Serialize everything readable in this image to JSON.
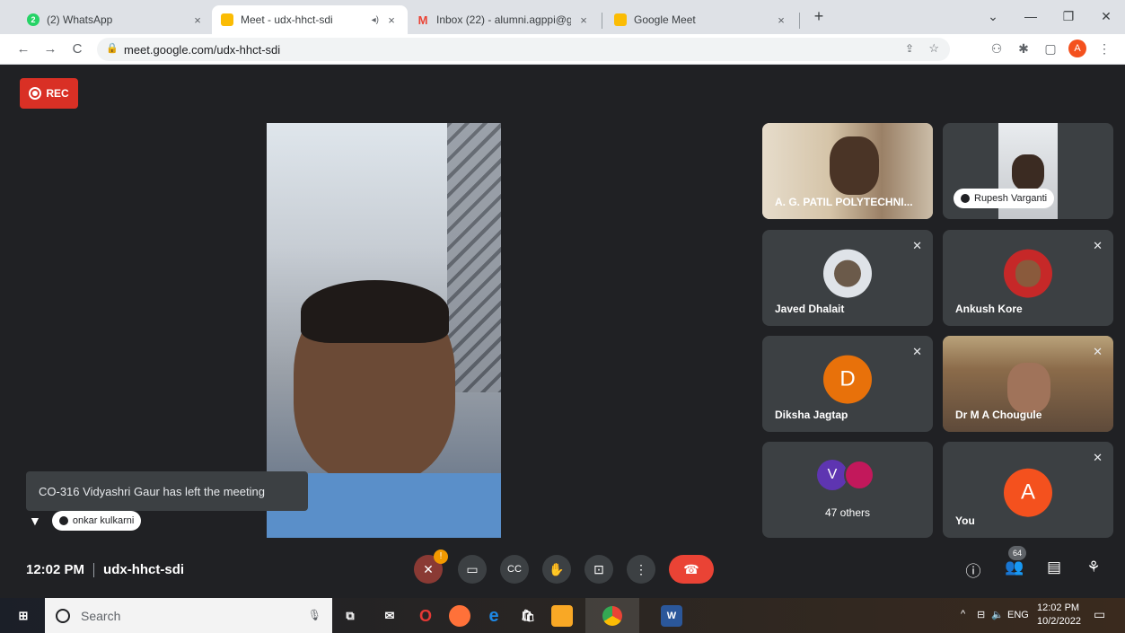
{
  "browser": {
    "tabs": [
      {
        "title": "(2) WhatsApp",
        "icon": "whatsapp-icon",
        "close": "×"
      },
      {
        "title": "Meet - udx-hhct-sdi",
        "icon": "meet-icon",
        "close": "×",
        "audio": "◂)"
      },
      {
        "title": "Inbox (22) - alumni.agppi@gmail",
        "icon": "gmail-icon",
        "close": "×"
      },
      {
        "title": "Google Meet",
        "icon": "meet-icon",
        "close": "×"
      }
    ],
    "new_tab": "+",
    "url": "meet.google.com/udx-hhct-sdi",
    "profile_initial": "A"
  },
  "meet": {
    "rec_label": "REC",
    "main_speaker_pin": "onkar kulkarni",
    "toast": "CO-316 Vidyashri Gaur has left the meeting",
    "tiles": [
      {
        "name": "A. G. PATIL POLYTECHNI...",
        "type": "video"
      },
      {
        "name": "Rupesh Varganti",
        "type": "video-pinned"
      },
      {
        "name": "Javed Dhalait",
        "type": "photo",
        "muted": true
      },
      {
        "name": "Ankush Kore",
        "type": "photo",
        "muted": true
      },
      {
        "name": "Diksha Jagtap",
        "type": "initial",
        "initial": "D",
        "color": "#e8710a",
        "muted": true
      },
      {
        "name": "Dr M A Chougule",
        "type": "video",
        "muted": true
      },
      {
        "name": "47 others",
        "type": "group",
        "initial": "V",
        "color": "#5e35b1"
      },
      {
        "name": "You",
        "type": "initial",
        "initial": "A",
        "color": "#f4511e",
        "muted": true
      }
    ],
    "time": "12:02 PM",
    "meeting_code": "udx-hhct-sdi",
    "participants_count": "64",
    "mic_warning": "!"
  },
  "taskbar": {
    "search_placeholder": "Search",
    "lang": "ENG",
    "clock_time": "12:02 PM",
    "clock_date": "10/2/2022"
  }
}
